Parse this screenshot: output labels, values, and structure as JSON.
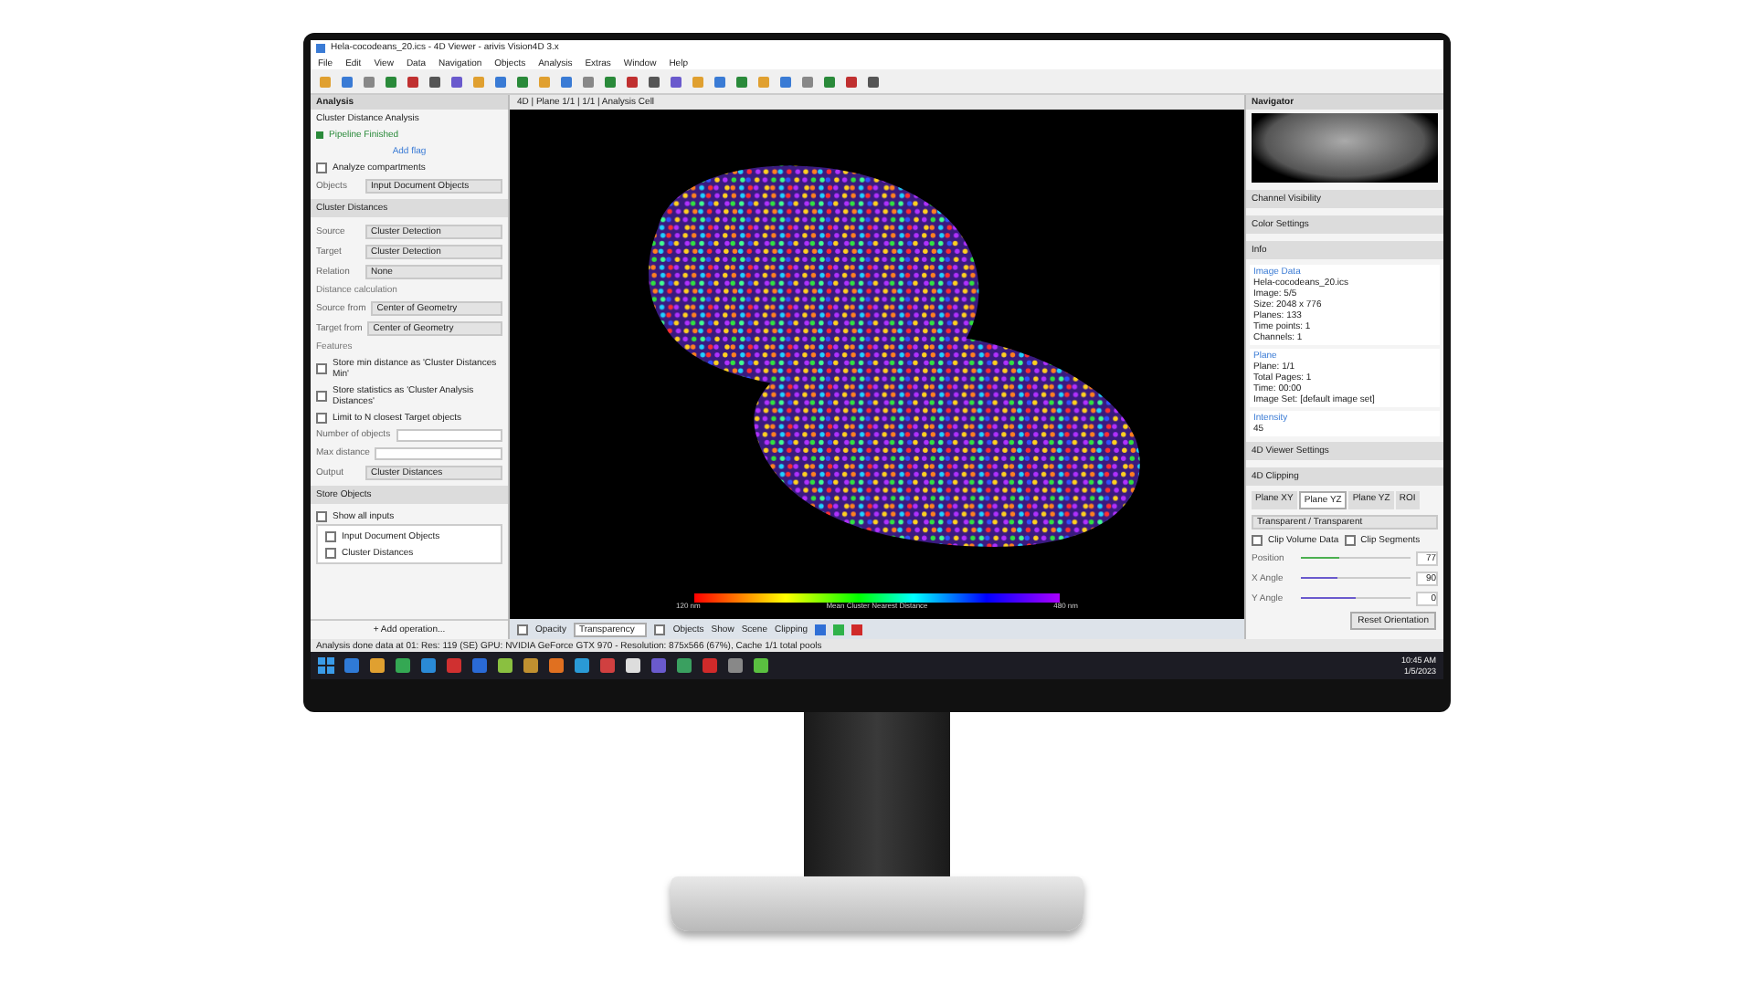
{
  "window": {
    "title": "Hela-cocodeans_20.ics - 4D Viewer - arivis Vision4D 3.x"
  },
  "menu": [
    "File",
    "Edit",
    "View",
    "Data",
    "Navigation",
    "Objects",
    "Analysis",
    "Extras",
    "Window",
    "Help"
  ],
  "analysis_panel": {
    "title": "Analysis",
    "heading": "Cluster Distance Analysis",
    "status": "Pipeline Finished",
    "rows": [
      {
        "kind": "link",
        "label": "Add flag"
      },
      {
        "kind": "check",
        "label": "Analyze compartments",
        "checked": false
      },
      {
        "kind": "field",
        "label": "Objects",
        "value": "Input Document Objects"
      },
      {
        "kind": "section",
        "label": "Cluster Distances"
      },
      {
        "kind": "field",
        "label": "Source",
        "value": "Cluster Detection"
      },
      {
        "kind": "field",
        "label": "Target",
        "value": "Cluster Detection"
      },
      {
        "kind": "field",
        "label": "Relation",
        "value": "None"
      },
      {
        "kind": "caption",
        "label": "Distance calculation"
      },
      {
        "kind": "field",
        "label": "Source from",
        "value": "Center of Geometry"
      },
      {
        "kind": "field",
        "label": "Target from",
        "value": "Center of Geometry"
      },
      {
        "kind": "caption",
        "label": "Features"
      },
      {
        "kind": "check",
        "label": "Store min distance as 'Cluster Distances Min'",
        "checked": false
      },
      {
        "kind": "check",
        "label": "Store statistics as 'Cluster Analysis Distances'",
        "checked": false
      },
      {
        "kind": "check",
        "label": "Limit to N closest Target objects",
        "checked": false
      },
      {
        "kind": "input",
        "label": "Number of objects"
      },
      {
        "kind": "input",
        "label": "Max distance"
      },
      {
        "kind": "field",
        "label": "Output",
        "value": "Cluster Distances"
      },
      {
        "kind": "section",
        "label": "Store Objects"
      },
      {
        "kind": "check",
        "label": "Show all inputs",
        "checked": false
      },
      {
        "kind": "tree",
        "label": "Input Document Objects",
        "checked": false
      },
      {
        "kind": "tree",
        "label": "Cluster Distances",
        "checked": false
      }
    ],
    "footer": "+ Add operation..."
  },
  "viewer": {
    "tab": "4D | Plane 1/1 | 1/1 | Analysis Cell",
    "colorbar": {
      "min": "120 nm",
      "title": "Mean Cluster Nearest Distance",
      "max": "480 nm"
    },
    "toolbar": [
      {
        "kind": "check",
        "label": "Opacity",
        "checked": false
      },
      {
        "kind": "select",
        "label": "Transparency"
      },
      {
        "kind": "check",
        "label": "Objects",
        "checked": false
      },
      {
        "kind": "text",
        "label": "Show"
      },
      {
        "kind": "text",
        "label": "Scene"
      },
      {
        "kind": "text",
        "label": "Clipping"
      }
    ],
    "clip_planes": [
      {
        "color": "#2f6fd6"
      },
      {
        "color": "#2fb24a"
      },
      {
        "color": "#d02a2a"
      }
    ]
  },
  "right_panel": {
    "navigator": "Navigator",
    "sections": [
      "Channel Visibility",
      "Color Settings",
      "Info"
    ],
    "image_data": {
      "heading": "Image Data",
      "lines": [
        "Hela-cocodeans_20.ics",
        "Image: 5/5",
        "Size: 2048 x 776",
        "Planes: 133",
        "Time points: 1",
        "Channels: 1"
      ]
    },
    "plane": {
      "heading": "Plane",
      "lines": [
        "Plane: 1/1",
        "Total Pages: 1",
        "Time: 00:00",
        "Image Set: [default image set]"
      ]
    },
    "intensity": {
      "heading": "Intensity",
      "value": "45"
    },
    "settings": [
      "4D Viewer Settings",
      "4D Clipping"
    ],
    "tabs": [
      {
        "label": "Plane XY",
        "selected": false
      },
      {
        "label": "Plane YZ",
        "selected": true
      },
      {
        "label": "Plane YZ",
        "selected": false
      },
      {
        "label": "ROI",
        "selected": false
      }
    ],
    "mode": "Transparent / Transparent",
    "checks": [
      {
        "label": "Clip Volume Data",
        "checked": false
      },
      {
        "label": "Clip Segments",
        "checked": false
      }
    ],
    "sliders": [
      {
        "label": "Position",
        "level": 0.35,
        "color": "#4caf50",
        "reading": "77"
      },
      {
        "label": "X Angle",
        "level": 0.33,
        "color": "#6a5acd",
        "reading": "90"
      },
      {
        "label": "Y Angle",
        "level": 0.5,
        "color": "#6a5acd",
        "reading": "0"
      }
    ],
    "button": "Reset Orientation"
  },
  "status_bar": "Analysis done data at 01: Res: 119 (SE) GPU: NVIDIA GeForce GTX 970 - Resolution: 875x566 (67%), Cache 1/1 total pools",
  "taskbar": {
    "time": "10:45 AM",
    "date": "1/5/2023"
  }
}
